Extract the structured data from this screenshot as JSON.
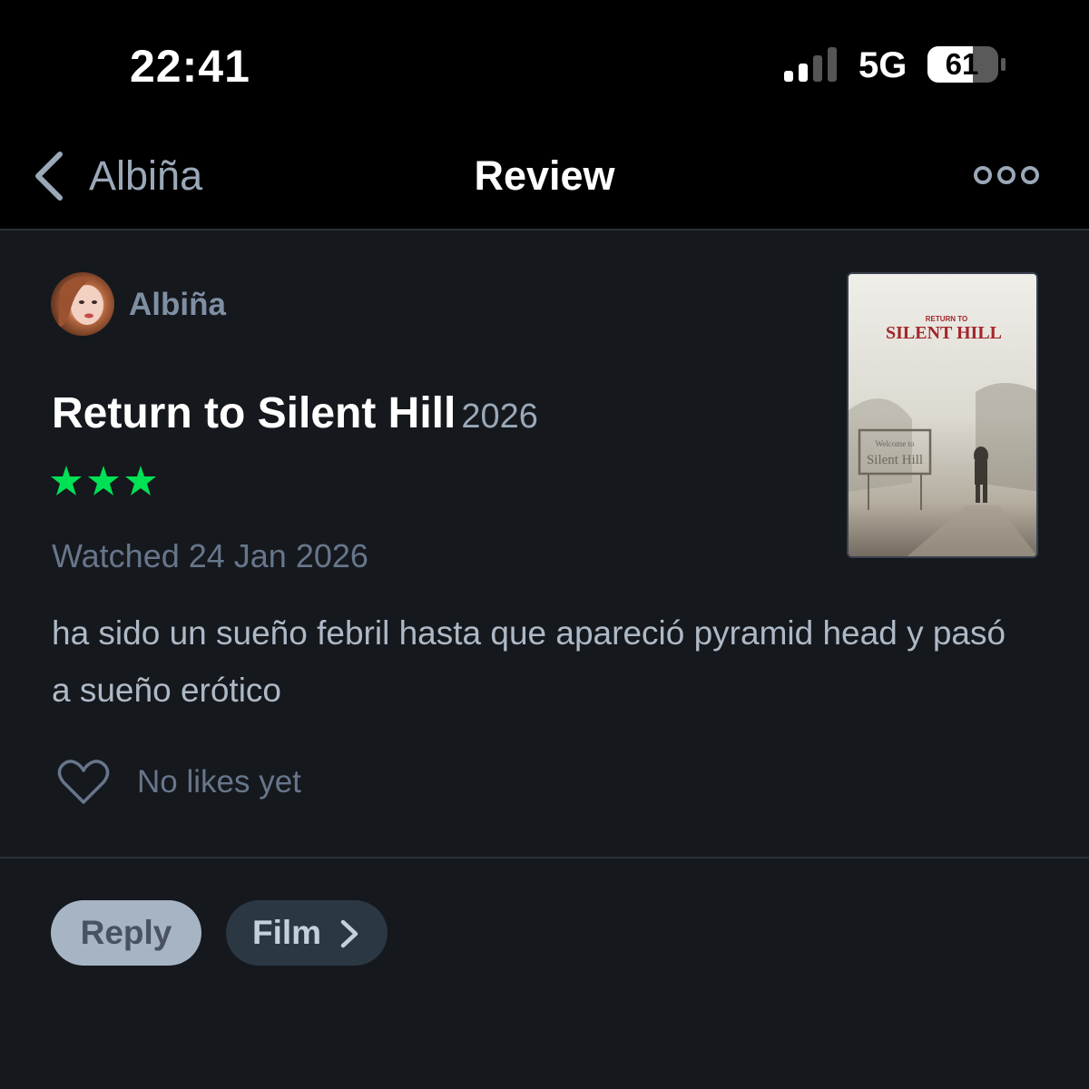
{
  "status_bar": {
    "time": "22:41",
    "network": "5G",
    "battery": "61",
    "signal_bars_active": 2,
    "signal_bars_total": 4
  },
  "navbar": {
    "back_label": "Albiña",
    "title": "Review",
    "back_icon": "chevron-left-icon",
    "more_icon": "more-horizontal-icon"
  },
  "review": {
    "username": "Albiña",
    "film_title": "Return to Silent Hill",
    "film_year": "2026",
    "rating_stars": 3,
    "watched": "Watched 24 Jan 2026",
    "body": "ha sido un sueño febril hasta que apareció pyramid head y pasó a sueño erótico",
    "likes_text": "No likes yet"
  },
  "poster": {
    "tagline": "RETURN TO",
    "title": "SILENT HILL",
    "sign_line1": "Welcome to",
    "sign_line2": "Silent Hill"
  },
  "actions": {
    "reply_label": "Reply",
    "film_label": "Film"
  },
  "colors": {
    "background": "#15181d",
    "bar_background": "#000000",
    "star_green": "#00e054",
    "poster_red": "#a3262a"
  }
}
